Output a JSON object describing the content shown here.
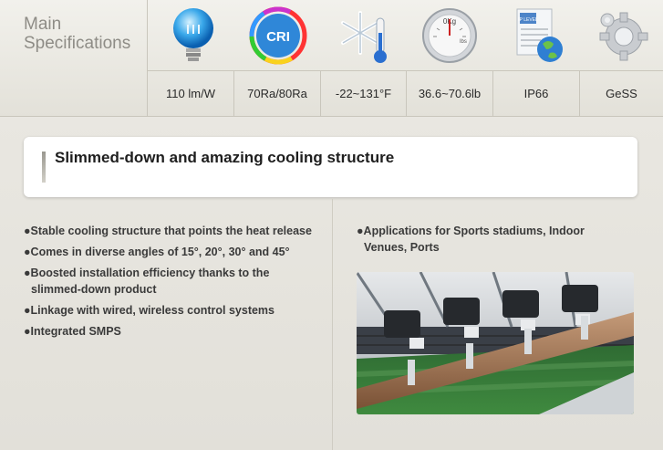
{
  "header": {
    "title_line1": "Main",
    "title_line2": "Specifications"
  },
  "specs": [
    {
      "icon": "light-bulb-icon",
      "value": "110 lm/W"
    },
    {
      "icon": "cri-badge-icon",
      "value": "70Ra/80Ra",
      "icon_text": "CRI"
    },
    {
      "icon": "snowflake-thermometer-icon",
      "value": "-22~131°F"
    },
    {
      "icon": "weight-scale-icon",
      "value": "36.6~70.6lb",
      "icon_text_top": "0Kg",
      "icon_text_side": "lbs"
    },
    {
      "icon": "ip-document-globe-icon",
      "value": "IP66",
      "icon_text": "IP LEVEL"
    },
    {
      "icon": "gears-icon",
      "value": "GeSS"
    }
  ],
  "banner": {
    "title": "Slimmed-down and amazing cooling structure"
  },
  "left_bullets": [
    "●Stable cooling structure that points the heat release",
    "●Comes in diverse angles of 15°, 20°, 30° and 45°",
    "●Boosted installation efficiency thanks to the slimmed-down product",
    "●Linkage with wired, wireless control systems",
    "●Integrated SMPS"
  ],
  "right_bullets": [
    "●Applications for Sports stadiums, Indoor Venues, Ports"
  ]
}
